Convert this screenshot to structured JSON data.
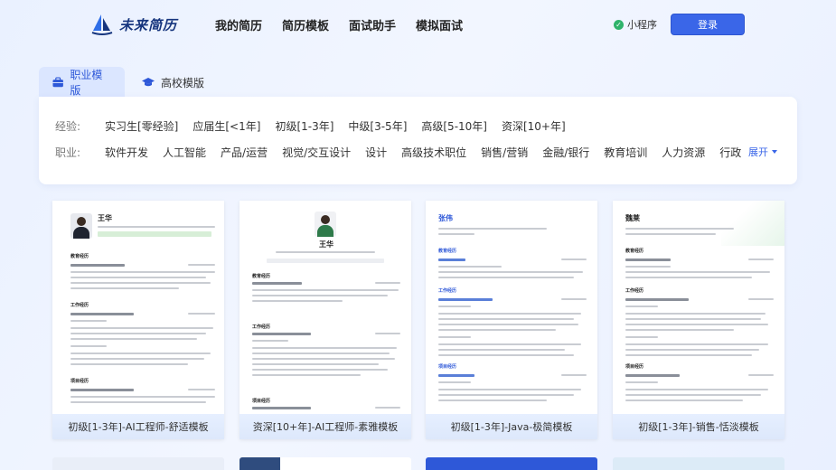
{
  "nav": {
    "brand": "未来简历",
    "items": [
      "我的简历",
      "简历模板",
      "面试助手",
      "模拟面试"
    ],
    "mini_program": "小程序",
    "login": "登录"
  },
  "tabs": [
    {
      "label": "职业模版",
      "icon": "briefcase-icon",
      "active": true
    },
    {
      "label": "高校模版",
      "icon": "graduation-cap-icon",
      "active": false
    }
  ],
  "filters": {
    "experience_label": "经验:",
    "experience_options": [
      "实习生[零经验]",
      "应届生[<1年]",
      "初级[1-3年]",
      "中级[3-5年]",
      "高级[5-10年]",
      "资深[10+年]"
    ],
    "job_label": "职业:",
    "job_options": [
      "软件开发",
      "人工智能",
      "产品/运营",
      "视觉/交互设计",
      "设计",
      "高级技术职位",
      "销售/营销",
      "金融/银行",
      "教育培训",
      "人力资源",
      "行政"
    ],
    "expand": "展开"
  },
  "templates": [
    {
      "caption": "初级[1-3年]-AI工程师-舒适模板",
      "name": "王华",
      "section1": "教育经历",
      "section2": "工作经历",
      "section3": "项目经历"
    },
    {
      "caption": "资深[10+年]-AI工程师-素雅模板",
      "name": "王华",
      "section1": "教育经历",
      "section2": "工作经历",
      "section3": "项目经历"
    },
    {
      "caption": "初级[1-3年]-Java-极简模板",
      "name": "张伟",
      "section1": "教育经历",
      "section2": "工作经历",
      "section3": "项目经历"
    },
    {
      "caption": "初级[1-3年]-销售-恬淡模板",
      "name": "魏莱",
      "section1": "教育经历",
      "section2": "工作经历",
      "section3": "项目经历"
    }
  ],
  "colors": {
    "accent": "#3a66e8",
    "brand": "#16357e",
    "tab_active_bg": "#dbe6ff"
  }
}
